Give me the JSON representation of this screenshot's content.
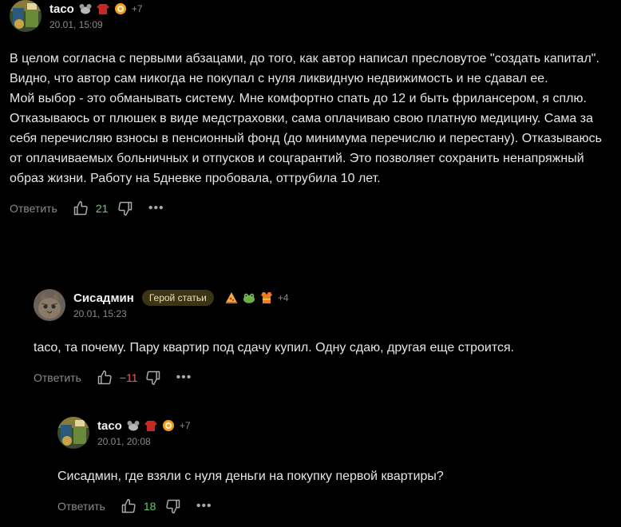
{
  "comments": [
    {
      "author": "taco",
      "extra_badges": "+7",
      "date": "20.01, 15:09",
      "paragraphs": [
        "В целом согласна с первыми абзацами, до того, как автор написал пресловутое \"создать капитал\". Видно, что автор сам никогда не покупал с нуля ликвидную недвижимость и не сдавал ее.",
        "Мой выбор - это обманывать систему. Мне комфортно спать до 12 и быть фрилансером, я сплю. Отказываюсь от плюшек в виде медстраховки, сама оплачиваю свою платную медицину. Сама за себя перечисляю взносы в пенсионный фонд (до минимума перечислю и перестану). Отказываюсь от оплачиваемых больничных и отпусков и соцгарантий. Это позволяет сохранить ненапряжный образ жизни. Работу на 5дневке пробовала, оттрубила 10 лет."
      ],
      "reply_label": "Ответить",
      "score": "21"
    },
    {
      "author": "Сисадмин",
      "hero_badge": "Герой статьи",
      "extra_badges": "+4",
      "date": "20.01, 15:23",
      "paragraphs": [
        "taco, та почему. Пару квартир под сдачу купил. Одну сдаю, другая еще строится."
      ],
      "reply_label": "Ответить",
      "score": "−11"
    },
    {
      "author": "taco",
      "extra_badges": "+7",
      "date": "20.01, 20:08",
      "paragraphs": [
        "Сисадмин, где взяли с нуля деньги на покупку первой квартиры?"
      ],
      "reply_label": "Ответить",
      "score": "18"
    }
  ],
  "colors": {
    "background": "#000000",
    "text": "#e6e6e6",
    "muted": "#8a8a8a",
    "positive": "#5fcf6a",
    "negative": "#f0605c",
    "hero_badge_bg": "#3b3417"
  },
  "icons": [
    "thumb-up-icon",
    "thumb-down-icon",
    "more-dots-icon",
    "mouse-badge-icon",
    "sweater-badge-icon",
    "coin-badge-icon",
    "pizza-badge-icon",
    "frog-badge-icon",
    "vest-badge-icon"
  ]
}
